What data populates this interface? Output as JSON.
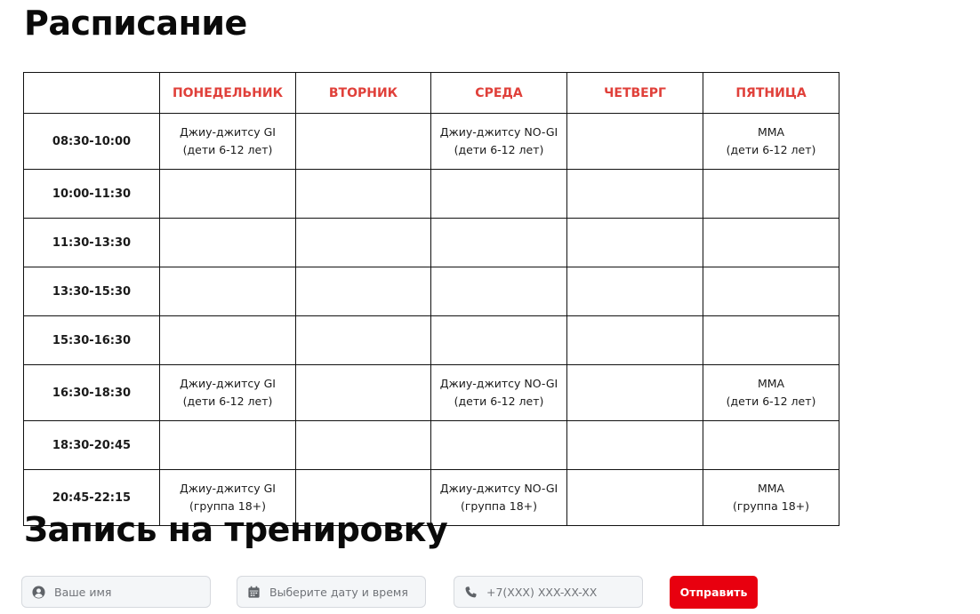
{
  "schedule": {
    "title": "Расписание",
    "days": [
      "ПОНЕДЕЛЬНИК",
      "ВТОРНИК",
      "СРЕДА",
      "ЧЕТВЕРГ",
      "ПЯТНИЦА"
    ],
    "rows": [
      {
        "time": "08:30-10:00",
        "cells": [
          [
            "Джиу-джитсу GI",
            "(дети 6-12 лет)"
          ],
          [],
          [
            "Джиу-джитсу NO-GI",
            "(дети 6-12 лет)"
          ],
          [],
          [
            "MMA",
            "(дети 6-12 лет)"
          ]
        ]
      },
      {
        "time": "10:00-11:30",
        "cells": [
          [],
          [],
          [],
          [],
          []
        ]
      },
      {
        "time": "11:30-13:30",
        "cells": [
          [],
          [],
          [],
          [],
          []
        ]
      },
      {
        "time": "13:30-15:30",
        "cells": [
          [],
          [],
          [],
          [],
          []
        ]
      },
      {
        "time": "15:30-16:30",
        "cells": [
          [],
          [],
          [],
          [],
          []
        ]
      },
      {
        "time": "16:30-18:30",
        "cells": [
          [
            "Джиу-джитсу GI",
            "(дети 6-12 лет)"
          ],
          [],
          [
            "Джиу-джитсу NO-GI",
            "(дети 6-12 лет)"
          ],
          [],
          [
            "MMA",
            "(дети 6-12 лет)"
          ]
        ]
      },
      {
        "time": "18:30-20:45",
        "cells": [
          [],
          [],
          [],
          [],
          []
        ]
      },
      {
        "time": "20:45-22:15",
        "cells": [
          [
            "Джиу-джитсу GI",
            "(группа 18+)"
          ],
          [],
          [
            "Джиу-джитсу NO-GI",
            "(группа 18+)"
          ],
          [],
          [
            "MMA",
            "(группа 18+)"
          ]
        ]
      }
    ]
  },
  "form": {
    "title": "Запись на тренировку",
    "name": {
      "icon": "user-icon",
      "placeholder": "Ваше имя",
      "value": ""
    },
    "date": {
      "icon": "calendar-icon",
      "placeholder": "Выберите дату и время",
      "value": ""
    },
    "phone": {
      "icon": "phone-icon",
      "placeholder": "+7(XXX) XXX-XX-XX",
      "value": ""
    },
    "submit_label": "Отправить"
  },
  "colors": {
    "day_header": "#e0403a",
    "submit_bg": "#e8000f"
  }
}
